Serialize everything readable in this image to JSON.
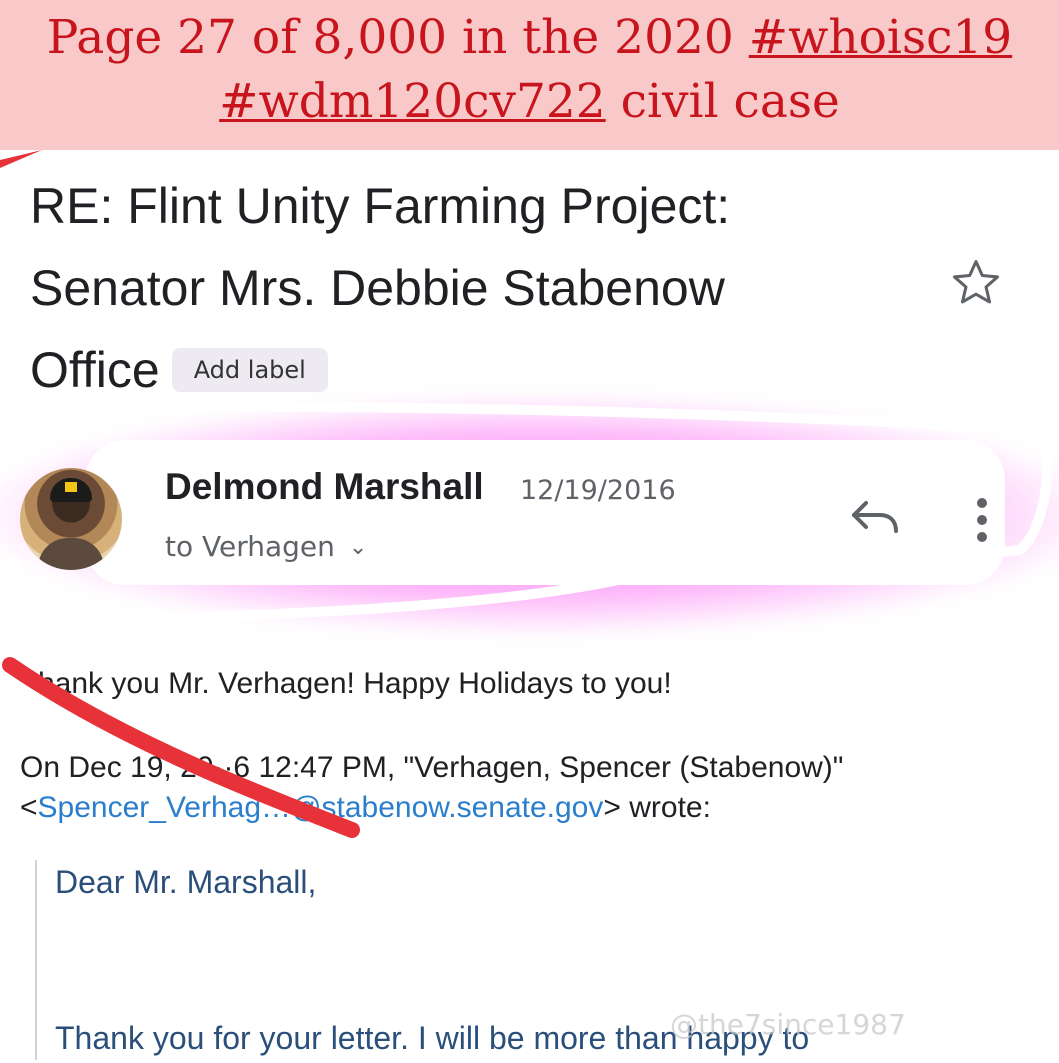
{
  "banner": {
    "line1_prefix": "Page 27 of 8,000 in the 2020 ",
    "line1_tag": "#whoisc19",
    "line2_tag": "#wdm120cv722",
    "line2_suffix": " civil case"
  },
  "email": {
    "subject_lines": [
      "RE: Flint Unity Farming Project:",
      "Senator Mrs. Debbie Stabenow",
      "Office"
    ],
    "add_label": "Add label",
    "sender_name": "Delmond Marshall",
    "date": "12/19/2016",
    "recipient": "to Verhagen",
    "body_thanks": "hank you Mr. Verhagen! Happy Holidays to you!",
    "quote_header_line1": "On Dec 19, 20··6 12:47 PM, \"Verhagen, Spencer (Stabenow)\"",
    "quote_open": "<",
    "quote_email": "Spencer_Verhag…@stabenow.senate.gov",
    "quote_close": "> wrote:",
    "quoted_dear": "Dear Mr. Marshall,",
    "quoted_letter": "Thank you for your letter. I will be more than happy to"
  },
  "watermark": "@the7since1987",
  "icons": [
    "star-icon",
    "reply-icon",
    "more-vert-icon",
    "chevron-down-icon",
    "avatar"
  ],
  "colors": {
    "banner_bg": "#f9c9c9",
    "banner_text": "#c8141c",
    "highlight": "#fa28f0",
    "link": "#2a7ecb",
    "slash": "#e8323a"
  }
}
